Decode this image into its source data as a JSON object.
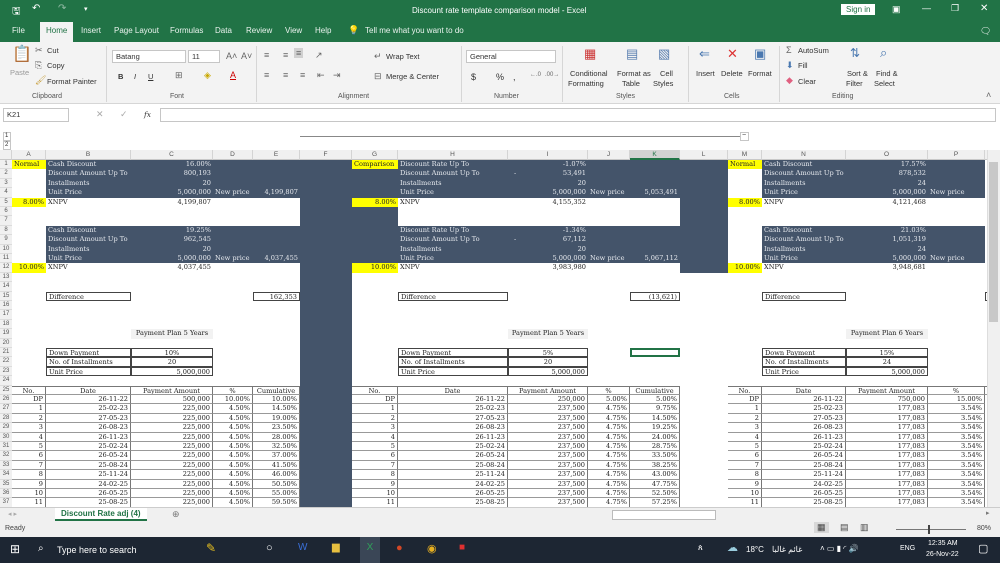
{
  "window": {
    "title": "Discount rate template comparison model  -  Excel",
    "sign_in": "Sign in"
  },
  "menu": {
    "tabs": [
      "File",
      "Home",
      "Insert",
      "Page Layout",
      "Formulas",
      "Data",
      "Review",
      "View",
      "Help"
    ],
    "tell_me": "Tell me what you want to do"
  },
  "ribbon": {
    "clipboard": {
      "paste": "Paste",
      "cut": "Cut",
      "copy": "Copy",
      "format_painter": "Format Painter",
      "label": "Clipboard"
    },
    "font": {
      "name": "Batang",
      "size": "11",
      "bold": "B",
      "italic": "I",
      "underline": "U",
      "label": "Font"
    },
    "alignment": {
      "wrap_text": "Wrap Text",
      "merge_center": "Merge & Center",
      "label": "Alignment"
    },
    "number": {
      "format": "General",
      "currency": "$",
      "percent": "%",
      "comma": ",",
      "label": "Number"
    },
    "styles": {
      "conditional": "Conditional",
      "conditional2": "Formatting",
      "format_as": "Format as",
      "table": "Table",
      "cell": "Cell",
      "cell2": "Styles",
      "label": "Styles"
    },
    "cells": {
      "insert": "Insert",
      "delete": "Delete",
      "format": "Format",
      "label": "Cells"
    },
    "editing": {
      "autosum": "AutoSum",
      "fill": "Fill",
      "clear": "Clear",
      "sort": "Sort &",
      "filter": "Filter",
      "find": "Find &",
      "select": "Select",
      "label": "Editing"
    }
  },
  "formula_bar": {
    "name_box": "K21",
    "fx": "fx",
    "value": ""
  },
  "columns": [
    "A",
    "B",
    "C",
    "D",
    "E",
    "F",
    "G",
    "H",
    "I",
    "J",
    "K",
    "L",
    "M",
    "N",
    "O",
    "P",
    "Q"
  ],
  "selected_column": "K",
  "panels": [
    {
      "label": "Normal",
      "rate1": "8.00%",
      "rate2": "10.00%",
      "s1": {
        "rows": [
          {
            "label": "Cash Discount",
            "value": "16.00%"
          },
          {
            "label": "Discount Amount Up To",
            "value": "800,193"
          },
          {
            "label": "Installments",
            "value": "20"
          },
          {
            "label": "Unit Price",
            "value": "5,000,000"
          }
        ],
        "new_price_label": "New price",
        "new_price": "4,199,807",
        "xnpv_label": "XNPV",
        "xnpv": "4,199,807"
      },
      "s2": {
        "rows": [
          {
            "label": "Cash Discount",
            "value": "19.25%"
          },
          {
            "label": "Discount Amount Up To",
            "value": "962,545"
          },
          {
            "label": "Installments",
            "value": "20"
          },
          {
            "label": "Unit Price",
            "value": "5,000,000"
          }
        ],
        "new_price_label": "New price",
        "new_price": "4,037,455",
        "xnpv_label": "XNPV",
        "xnpv": "4,037,455"
      },
      "difference_label": "Difference",
      "difference": "162,353",
      "plan_title": "Payment Plan 5 Years",
      "inputs": [
        {
          "label": "Down Payment",
          "value": "10%"
        },
        {
          "label": "No. of Installments",
          "value": "20"
        },
        {
          "label": "Unit Price",
          "value": "5,000,000"
        }
      ],
      "table": {
        "headers": [
          "No.",
          "Date",
          "Payment Amount",
          "%",
          "Cumulative"
        ],
        "rows": [
          [
            "DP",
            "26-11-22",
            "500,000",
            "10.00%",
            "10.00%"
          ],
          [
            "1",
            "25-02-23",
            "225,000",
            "4.50%",
            "14.50%"
          ],
          [
            "2",
            "27-05-23",
            "225,000",
            "4.50%",
            "19.00%"
          ],
          [
            "3",
            "26-08-23",
            "225,000",
            "4.50%",
            "23.50%"
          ],
          [
            "4",
            "26-11-23",
            "225,000",
            "4.50%",
            "28.00%"
          ],
          [
            "5",
            "25-02-24",
            "225,000",
            "4.50%",
            "32.50%"
          ],
          [
            "6",
            "26-05-24",
            "225,000",
            "4.50%",
            "37.00%"
          ],
          [
            "7",
            "25-08-24",
            "225,000",
            "4.50%",
            "41.50%"
          ],
          [
            "8",
            "25-11-24",
            "225,000",
            "4.50%",
            "46.00%"
          ],
          [
            "9",
            "24-02-25",
            "225,000",
            "4.50%",
            "50.50%"
          ],
          [
            "10",
            "26-05-25",
            "225,000",
            "4.50%",
            "55.00%"
          ],
          [
            "11",
            "25-08-25",
            "225,000",
            "4.50%",
            "59.50%"
          ]
        ]
      }
    },
    {
      "label": "Comparison",
      "rate1": "8.00%",
      "rate2": "10.00%",
      "s1": {
        "rows": [
          {
            "label": "Discount Rate Up To",
            "value": "-1.07%"
          },
          {
            "label": "Discount Amount Up To",
            "value": "53,491",
            "dash": "-"
          },
          {
            "label": "Installments",
            "value": "20"
          },
          {
            "label": "Unit Price",
            "value": "5,000,000"
          }
        ],
        "new_price_label": "New price",
        "new_price": "5,053,491",
        "xnpv_label": "XNPV",
        "xnpv": "4,155,352"
      },
      "s2": {
        "rows": [
          {
            "label": "Discount Rate Up To",
            "value": "-1.34%"
          },
          {
            "label": "Discount Amount Up To",
            "value": "67,112",
            "dash": "-"
          },
          {
            "label": "Installments",
            "value": "20"
          },
          {
            "label": "Unit Price",
            "value": "5,000,000"
          }
        ],
        "new_price_label": "New price",
        "new_price": "5,067,112",
        "xnpv_label": "XNPV",
        "xnpv": "3,983,980"
      },
      "difference_label": "Difference",
      "difference": "(13,621)",
      "plan_title": "Payment Plan 5 Years",
      "inputs": [
        {
          "label": "Down Payment",
          "value": "5%"
        },
        {
          "label": "No. of Installments",
          "value": "20"
        },
        {
          "label": "Unit Price",
          "value": "5,000,000"
        }
      ],
      "table": {
        "headers": [
          "No.",
          "Date",
          "Payment Amount",
          "%",
          "Cumulative"
        ],
        "rows": [
          [
            "DP",
            "26-11-22",
            "250,000",
            "5.00%",
            "5.00%"
          ],
          [
            "1",
            "25-02-23",
            "237,500",
            "4.75%",
            "9.75%"
          ],
          [
            "2",
            "27-05-23",
            "237,500",
            "4.75%",
            "14.50%"
          ],
          [
            "3",
            "26-08-23",
            "237,500",
            "4.75%",
            "19.25%"
          ],
          [
            "4",
            "26-11-23",
            "237,500",
            "4.75%",
            "24.00%"
          ],
          [
            "5",
            "25-02-24",
            "237,500",
            "4.75%",
            "28.75%"
          ],
          [
            "6",
            "26-05-24",
            "237,500",
            "4.75%",
            "33.50%"
          ],
          [
            "7",
            "25-08-24",
            "237,500",
            "4.75%",
            "38.25%"
          ],
          [
            "8",
            "25-11-24",
            "237,500",
            "4.75%",
            "43.00%"
          ],
          [
            "9",
            "24-02-25",
            "237,500",
            "4.75%",
            "47.75%"
          ],
          [
            "10",
            "26-05-25",
            "237,500",
            "4.75%",
            "52.50%"
          ],
          [
            "11",
            "25-08-25",
            "237,500",
            "4.75%",
            "57.25%"
          ]
        ]
      }
    },
    {
      "label": "Normal",
      "rate1": "8.00%",
      "rate2": "10.00%",
      "s1": {
        "rows": [
          {
            "label": "Cash Discount",
            "value": "17.57%"
          },
          {
            "label": "Discount Amount Up To",
            "value": "878,532"
          },
          {
            "label": "Installments",
            "value": "24"
          },
          {
            "label": "Unit Price",
            "value": "5,000,000"
          }
        ],
        "new_price_label": "New price",
        "xnpv_label": "XNPV",
        "xnpv": "4,121,468"
      },
      "s2": {
        "rows": [
          {
            "label": "Cash Discount",
            "value": "21.03%"
          },
          {
            "label": "Discount Amount Up To",
            "value": "1,051,319"
          },
          {
            "label": "Installments",
            "value": "24"
          },
          {
            "label": "Unit Price",
            "value": "5,000,000"
          }
        ],
        "new_price_label": "New price",
        "xnpv_label": "XNPV",
        "xnpv": "3,948,681"
      },
      "difference_label": "Difference",
      "plan_title": "Payment Plan 6 Years",
      "inputs": [
        {
          "label": "Down Payment",
          "value": "15%"
        },
        {
          "label": "No. of Installments",
          "value": "24"
        },
        {
          "label": "Unit Price",
          "value": "5,000,000"
        }
      ],
      "table": {
        "headers": [
          "No.",
          "Date",
          "Payment Amount",
          "%",
          "Cu"
        ],
        "rows": [
          [
            "DP",
            "26-11-22",
            "750,000",
            "15.00%"
          ],
          [
            "1",
            "25-02-23",
            "177,083",
            "3.54%"
          ],
          [
            "2",
            "27-05-23",
            "177,083",
            "3.54%"
          ],
          [
            "3",
            "26-08-23",
            "177,083",
            "3.54%"
          ],
          [
            "4",
            "26-11-23",
            "177,083",
            "3.54%"
          ],
          [
            "5",
            "25-02-24",
            "177,083",
            "3.54%"
          ],
          [
            "6",
            "26-05-24",
            "177,083",
            "3.54%"
          ],
          [
            "7",
            "25-08-24",
            "177,083",
            "3.54%"
          ],
          [
            "8",
            "25-11-24",
            "177,083",
            "3.54%"
          ],
          [
            "9",
            "24-02-25",
            "177,083",
            "3.54%"
          ],
          [
            "10",
            "26-05-25",
            "177,083",
            "3.54%"
          ],
          [
            "11",
            "25-08-25",
            "177,083",
            "3.54%"
          ]
        ]
      }
    }
  ],
  "sheet_tab": "Discount Rate adj (4)",
  "status": {
    "ready": "Ready",
    "zoom": "80%"
  },
  "taskbar": {
    "search": "Type here to search",
    "weather": "18°C",
    "weather_text": "غائم غالبا",
    "lang": "ENG",
    "time": "12:35 AM",
    "date": "26-Nov-22"
  },
  "colors": {
    "excel_green": "#217346",
    "dark_band": "#44546a",
    "highlight": "#ffff00"
  }
}
